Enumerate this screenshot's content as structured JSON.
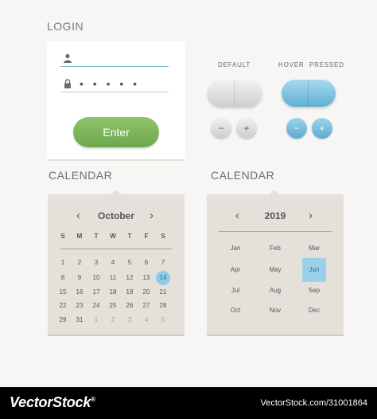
{
  "login": {
    "title": "LOGIN",
    "username_value": "",
    "password_mask": "• • • • •",
    "enter_label": "Enter",
    "accent": "#79b6d0",
    "enter_color": "#7cb65a"
  },
  "buttons": {
    "default_label": "DEFAULT",
    "hover_label": "HOVER",
    "pressed_label": "PRESSED",
    "minus": "−",
    "plus": "+",
    "blue_color": "#6fb9da",
    "gray_color": "#d8d8d8"
  },
  "cal_days": {
    "title": "CALENDAR",
    "prev": "‹",
    "next": "›",
    "month": "October",
    "weekdays": [
      "S",
      "M",
      "T",
      "W",
      "T",
      "F",
      "S"
    ],
    "weeks": [
      [
        "1",
        "2",
        "3",
        "4",
        "5",
        "6",
        "7"
      ],
      [
        "8",
        "9",
        "10",
        "11",
        "12",
        "13",
        "14"
      ],
      [
        "15",
        "16",
        "17",
        "18",
        "19",
        "20",
        "21"
      ],
      [
        "22",
        "23",
        "24",
        "25",
        "26",
        "27",
        "28"
      ],
      [
        "29",
        "31",
        "1",
        "2",
        "3",
        "4",
        "5"
      ]
    ],
    "selected": "14",
    "highlight": "#8ecbe7"
  },
  "cal_months": {
    "title": "CALENDAR",
    "prev": "‹",
    "next": "›",
    "year": "2019",
    "months": [
      [
        "Jan",
        "Feb",
        "Mar"
      ],
      [
        "Apr",
        "May",
        "Jun"
      ],
      [
        "Jul",
        "Aug",
        "Sep"
      ],
      [
        "Oct",
        "Nov",
        "Dec"
      ]
    ],
    "selected": "Jun",
    "highlight": "#9bd0ea"
  },
  "footer": {
    "brand": "VectorStock",
    "reg": "®",
    "url": "VectorStock.com/31001864"
  }
}
